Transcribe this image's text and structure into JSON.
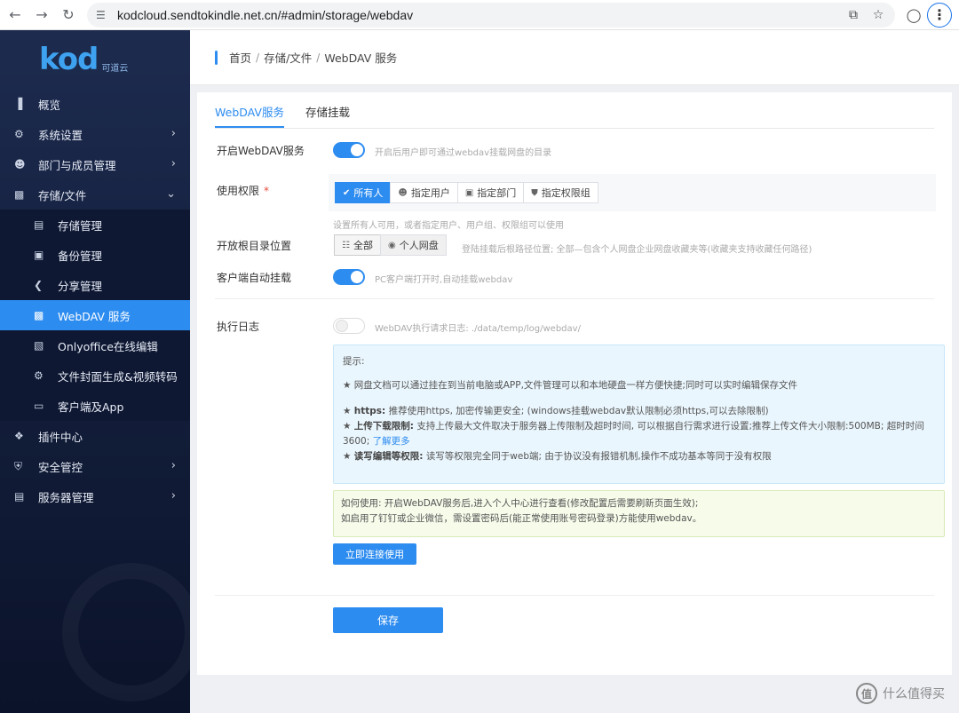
{
  "browser": {
    "url": "kodcloud.sendtokindle.net.cn/#admin/storage/webdav",
    "icons": [
      "back-icon",
      "forward-icon",
      "reload-icon",
      "site-info-icon",
      "install-icon",
      "star-icon",
      "profile-icon",
      "menu-icon"
    ]
  },
  "logo": {
    "main": "kod",
    "sub": "可道云"
  },
  "sidebar": {
    "items": [
      {
        "label": "概览",
        "icon": "chart-icon"
      },
      {
        "label": "系统设置",
        "icon": "gear-icon"
      },
      {
        "label": "部门与成员管理",
        "icon": "users-icon"
      },
      {
        "label": "存储/文件",
        "icon": "folder-icon"
      },
      {
        "label": "插件中心",
        "icon": "plugin-icon"
      },
      {
        "label": "安全管控",
        "icon": "shield-icon"
      },
      {
        "label": "服务器管理",
        "icon": "server-icon"
      }
    ],
    "subitems": [
      {
        "label": "存储管理",
        "icon": "database-icon"
      },
      {
        "label": "备份管理",
        "icon": "backup-icon"
      },
      {
        "label": "分享管理",
        "icon": "share-icon"
      },
      {
        "label": "WebDAV 服务",
        "icon": "webdav-icon"
      },
      {
        "label": "Onlyoffice在线编辑",
        "icon": "office-icon"
      },
      {
        "label": "文件封面生成&视频转码",
        "icon": "cover-icon"
      },
      {
        "label": "客户端及App",
        "icon": "monitor-icon"
      }
    ]
  },
  "breadcrumb": {
    "home": "首页",
    "storage": "存储/文件",
    "current": "WebDAV 服务",
    "sep": "/"
  },
  "tabs": {
    "webdav": "WebDAV服务",
    "mount": "存储挂载"
  },
  "form": {
    "enable": {
      "label": "开启WebDAV服务",
      "hint": "开启后用户即可通过webdav挂载网盘的目录",
      "on": true
    },
    "permission": {
      "label": "使用权限",
      "required_mark": "*",
      "options": [
        "所有人",
        "指定用户",
        "指定部门",
        "指定权限组"
      ],
      "selected": "所有人",
      "hint": "设置所有人可用，或者指定用户、用户组、权限组可以使用"
    },
    "root": {
      "label": "开放根目录位置",
      "options": [
        "全部",
        "个人网盘"
      ],
      "selected": "全部",
      "hint": "登陆挂载后根路径位置; 全部—包含个人网盘企业网盘收藏夹等(收藏夹支持收藏任何路径)"
    },
    "auto_mount": {
      "label": "客户端自动挂载",
      "hint": "PC客户端打开时,自动挂载webdav",
      "on": true
    },
    "log": {
      "label": "执行日志",
      "hint": "WebDAV执行请求日志: ./data/temp/log/webdav/",
      "on": false
    }
  },
  "tips": {
    "title": "提示:",
    "line1": "★ 网盘文档可以通过挂在到当前电脑或APP,文件管理可以和本地硬盘一样方便快捷;同时可以实时编辑保存文件",
    "https_title": "https:",
    "https_text": "推荐使用https, 加密传输更安全; (windows挂载webdav默认限制必须https,可以去除限制)",
    "upload_title": "上传下载限制:",
    "upload_text": "支持上传最大文件取决于服务器上传限制及超时时间, 可以根据自行需求进行设置;推荐上传文件大小限制:500MB; 超时时间 3600;",
    "upload_link": "了解更多",
    "rw_title": "读写编辑等权限:",
    "rw_text": "读写等权限完全同于web端; 由于协议没有报错机制,操作不成功基本等同于没有权限",
    "star": "★"
  },
  "usage": {
    "line1": "如何使用: 开启WebDAV服务后,进入个人中心进行查看(修改配置后需要刷新页面生效);",
    "line2": "如启用了钉钉或企业微信，需设置密码后(能正常使用账号密码登录)方能使用webdav。"
  },
  "buttons": {
    "connect": "立即连接使用",
    "save": "保存"
  },
  "watermark": {
    "text": "什么值得买",
    "icon_text": "值"
  },
  "colors": {
    "accent": "#2d8cf0",
    "sidebar_bg": "#121d39"
  }
}
